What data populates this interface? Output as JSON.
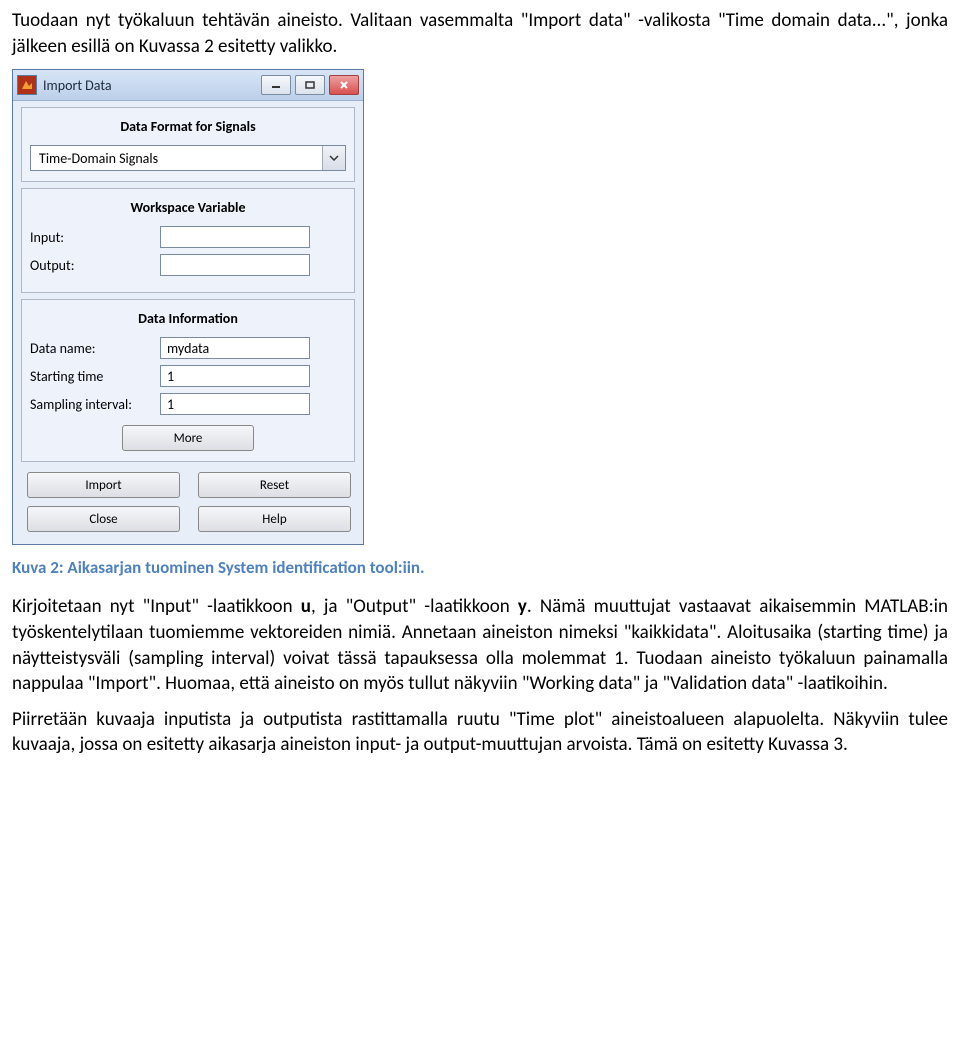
{
  "paragraphs": {
    "intro": "Tuodaan nyt työkaluun tehtävän aineisto. Valitaan vasemmalta \"Import data\" -valikosta \"Time domain data...\", jonka jälkeen esillä on Kuvassa 2 esitetty valikko.",
    "caption": "Kuva 2: Aikasarjan tuominen System identification tool:iin.",
    "p1a": "Kirjoitetaan nyt \"Input\" -laatikkoon ",
    "p1_u": "u",
    "p1b": ", ja \"Output\" -laatikkoon ",
    "p1_y": "y",
    "p1c": ". Nämä muuttujat vastaavat aikaisemmin MATLAB:in työskentelytilaan tuomiemme vektoreiden nimiä. Annetaan aineiston nimeksi \"kaikkidata\". Aloitusaika (starting time) ja näytteistysväli (sampling interval) voivat tässä tapauksessa olla molemmat 1. Tuodaan aineisto työkaluun painamalla nappulaa \"Import\". Huomaa, että aineisto on myös tullut näkyviin \"Working data\" ja \"Validation data\" -laatikoihin.",
    "p2": "Piirretään kuvaaja inputista ja outputista rastittamalla ruutu \"Time plot\" aineistoalueen alapuolelta. Näkyviin tulee kuvaaja, jossa on esitetty aikasarja aineiston input- ja output-muuttujan arvoista. Tämä on esitetty Kuvassa 3."
  },
  "dialog": {
    "title": "Import Data",
    "dataFormat": {
      "heading": "Data Format for Signals",
      "selected": "Time-Domain Signals"
    },
    "workspace": {
      "heading": "Workspace Variable",
      "inputLabel": "Input:",
      "outputLabel": "Output:",
      "inputValue": "",
      "outputValue": ""
    },
    "info": {
      "heading": "Data Information",
      "nameLabel": "Data name:",
      "nameValue": "mydata",
      "startLabel": "Starting time",
      "startValue": "1",
      "sampleLabel": "Sampling interval:",
      "sampleValue": "1",
      "moreLabel": "More"
    },
    "buttons": {
      "import": "Import",
      "reset": "Reset",
      "close": "Close",
      "help": "Help"
    }
  }
}
